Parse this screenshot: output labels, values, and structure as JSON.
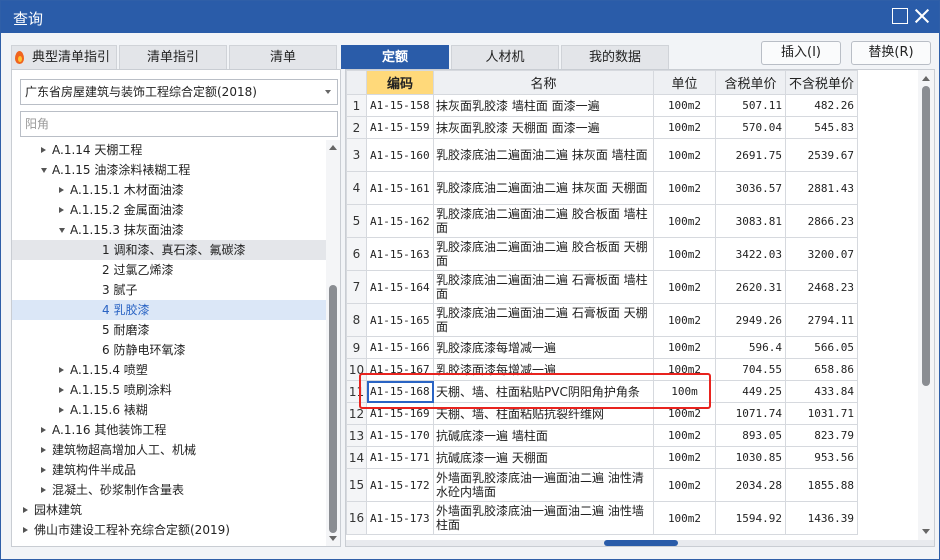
{
  "window": {
    "title": "查询"
  },
  "tabs": [
    {
      "label": "典型清单指引",
      "active": false
    },
    {
      "label": "清单指引",
      "active": false
    },
    {
      "label": "清单",
      "active": false
    },
    {
      "label": "定额",
      "active": true
    },
    {
      "label": "人材机",
      "active": false
    },
    {
      "label": "我的数据",
      "active": false
    }
  ],
  "actions": {
    "insert": "插入(I)",
    "replace": "替换(R)"
  },
  "left": {
    "library": "广东省房屋建筑与装饰工程综合定额(2018)",
    "search_placeholder": "阳角",
    "tree": [
      {
        "label": "A.1.14 天棚工程",
        "toggle": "right",
        "indent": 2
      },
      {
        "label": "A.1.15 油漆涂料裱糊工程",
        "toggle": "down",
        "indent": 2
      },
      {
        "label": "A.1.15.1 木材面油漆",
        "toggle": "right",
        "indent": 3
      },
      {
        "label": "A.1.15.2 金属面油漆",
        "toggle": "right",
        "indent": 3
      },
      {
        "label": "A.1.15.3 抹灰面油漆",
        "toggle": "down",
        "indent": 3
      },
      {
        "label": "1 调和漆、真石漆、氟碳漆",
        "toggle": "",
        "indent": 5,
        "selected": true
      },
      {
        "label": "2 过氯乙烯漆",
        "toggle": "",
        "indent": 5
      },
      {
        "label": "3 腻子",
        "toggle": "",
        "indent": 5
      },
      {
        "label": "4 乳胶漆",
        "toggle": "",
        "indent": 5,
        "highlight": true
      },
      {
        "label": "5 耐磨漆",
        "toggle": "",
        "indent": 5
      },
      {
        "label": "6 防静电环氧漆",
        "toggle": "",
        "indent": 5
      },
      {
        "label": "A.1.15.4 喷塑",
        "toggle": "right",
        "indent": 3
      },
      {
        "label": "A.1.15.5 喷刷涂料",
        "toggle": "right",
        "indent": 3
      },
      {
        "label": "A.1.15.6 裱糊",
        "toggle": "right",
        "indent": 3
      },
      {
        "label": "A.1.16 其他装饰工程",
        "toggle": "right",
        "indent": 2
      },
      {
        "label": "建筑物超高增加人工、机械",
        "toggle": "right",
        "indent": 2
      },
      {
        "label": "建筑构件半成品",
        "toggle": "right",
        "indent": 2
      },
      {
        "label": "混凝土、砂浆制作含量表",
        "toggle": "right",
        "indent": 2
      },
      {
        "label": "园林建筑",
        "toggle": "right",
        "indent": 1
      },
      {
        "label": "佛山市建设工程补充综合定额(2019)",
        "toggle": "right",
        "indent": 1
      }
    ]
  },
  "grid": {
    "headers": [
      "",
      "编码",
      "名称",
      "单位",
      "含税单价",
      "不含税单价"
    ],
    "active_header": 1,
    "rows": [
      {
        "no": "1",
        "code": "A1-15-158",
        "name": "抹灰面乳胶漆 墙柱面 面漆一遍",
        "unit": "100m2",
        "tax": "507.11",
        "notax": "482.26"
      },
      {
        "no": "2",
        "code": "A1-15-159",
        "name": "抹灰面乳胶漆 天棚面 面漆一遍",
        "unit": "100m2",
        "tax": "570.04",
        "notax": "545.83"
      },
      {
        "no": "3",
        "code": "A1-15-160",
        "name": "乳胶漆底油二遍面油二遍 抹灰面 墙柱面",
        "unit": "100m2",
        "tax": "2691.75",
        "notax": "2539.67",
        "tall": true
      },
      {
        "no": "4",
        "code": "A1-15-161",
        "name": "乳胶漆底油二遍面油二遍 抹灰面 天棚面",
        "unit": "100m2",
        "tax": "3036.57",
        "notax": "2881.43",
        "tall": true
      },
      {
        "no": "5",
        "code": "A1-15-162",
        "name": "乳胶漆底油二遍面油二遍 胶合板面 墙柱面",
        "unit": "100m2",
        "tax": "3083.81",
        "notax": "2866.23",
        "tall": true
      },
      {
        "no": "6",
        "code": "A1-15-163",
        "name": "乳胶漆底油二遍面油二遍 胶合板面 天棚面",
        "unit": "100m2",
        "tax": "3422.03",
        "notax": "3200.07",
        "tall": true
      },
      {
        "no": "7",
        "code": "A1-15-164",
        "name": "乳胶漆底油二遍面油二遍 石膏板面 墙柱面",
        "unit": "100m2",
        "tax": "2620.31",
        "notax": "2468.23",
        "tall": true
      },
      {
        "no": "8",
        "code": "A1-15-165",
        "name": "乳胶漆底油二遍面油二遍 石膏板面 天棚面",
        "unit": "100m2",
        "tax": "2949.26",
        "notax": "2794.11",
        "tall": true
      },
      {
        "no": "9",
        "code": "A1-15-166",
        "name": "乳胶漆底漆每增减一遍",
        "unit": "100m2",
        "tax": "596.4",
        "notax": "566.05"
      },
      {
        "no": "10",
        "code": "A1-15-167",
        "name": "乳胶漆面漆每增减一遍",
        "unit": "100m2",
        "tax": "704.55",
        "notax": "658.86"
      },
      {
        "no": "11",
        "code": "A1-15-168",
        "name": "天棚、墙、柱面粘贴PVC阴阳角护角条",
        "unit": "100m",
        "tax": "449.25",
        "notax": "433.84",
        "current": true
      },
      {
        "no": "12",
        "code": "A1-15-169",
        "name": "天棚、墙、柱面粘贴抗裂纤维网",
        "unit": "100m2",
        "tax": "1071.74",
        "notax": "1031.71"
      },
      {
        "no": "13",
        "code": "A1-15-170",
        "name": "抗碱底漆一遍 墙柱面",
        "unit": "100m2",
        "tax": "893.05",
        "notax": "823.79"
      },
      {
        "no": "14",
        "code": "A1-15-171",
        "name": "抗碱底漆一遍 天棚面",
        "unit": "100m2",
        "tax": "1030.85",
        "notax": "953.56"
      },
      {
        "no": "15",
        "code": "A1-15-172",
        "name": "外墙面乳胶漆底油一遍面油二遍 油性清水砼内墙面",
        "unit": "100m2",
        "tax": "2034.28",
        "notax": "1855.88",
        "tall": true
      },
      {
        "no": "16",
        "code": "A1-15-173",
        "name": "外墙面乳胶漆底油一遍面油二遍 油性墙柱面",
        "unit": "100m2",
        "tax": "1594.92",
        "notax": "1436.39",
        "tall": true
      }
    ]
  },
  "colors": {
    "titlebar": "#2a5ca9",
    "highlight_box": "#e8231e",
    "active_header": "#ffd97a"
  }
}
